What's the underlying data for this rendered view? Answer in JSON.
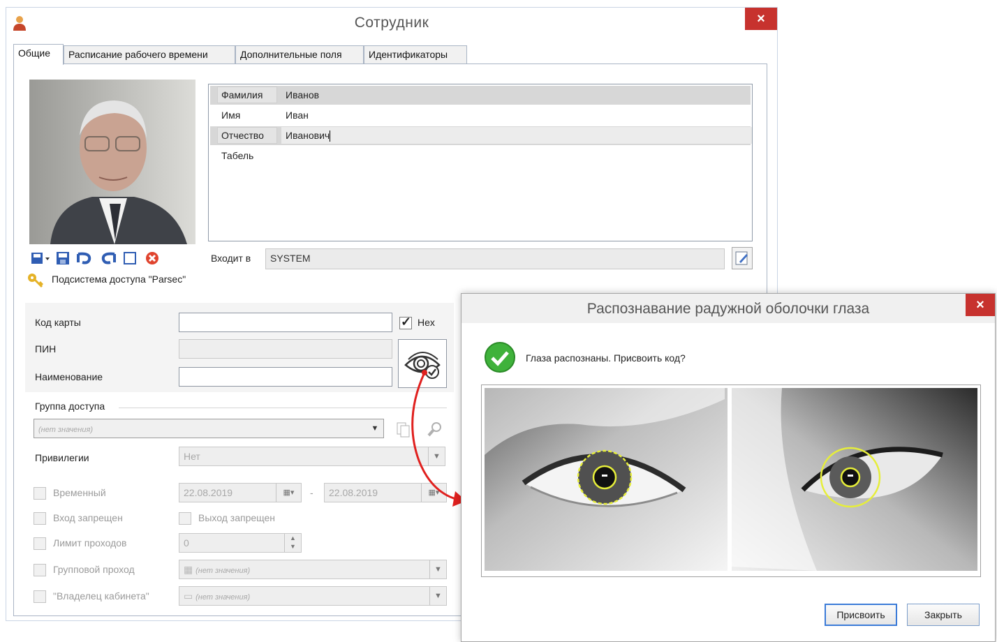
{
  "window": {
    "title": "Сотрудник",
    "close": "×"
  },
  "tabs": [
    {
      "label": "Общие"
    },
    {
      "label": "Расписание рабочего времени"
    },
    {
      "label": "Дополнительные поля"
    },
    {
      "label": "Идентификаторы"
    }
  ],
  "person": {
    "rows": [
      {
        "key": "Фамилия",
        "value": "Иванов"
      },
      {
        "key": "Имя",
        "value": "Иван"
      },
      {
        "key": "Отчество",
        "value": "Иванович"
      },
      {
        "key": "Табель",
        "value": ""
      }
    ]
  },
  "org": {
    "label": "Входит в",
    "value": "SYSTEM"
  },
  "subsystem": {
    "label": "Подсистема доступа \"Parsec\""
  },
  "access": {
    "card_code_label": "Код карты",
    "card_code_value": "",
    "hex_label": "Hex",
    "hex_checked": true,
    "pin_label": "ПИН",
    "name_label": "Наименование",
    "name_value": "",
    "group_label": "Группа доступа",
    "group_placeholder": "(нет значения)",
    "privileges_label": "Привилегии",
    "privileges_value": "Нет",
    "temporary_label": "Временный",
    "date_from": "22.08.2019",
    "date_to": "22.08.2019",
    "date_sep": "-",
    "entry_forbidden_label": "Вход запрещен",
    "exit_forbidden_label": "Выход запрещен",
    "pass_limit_label": "Лимит проходов",
    "pass_limit_value": "0",
    "group_pass_label": "Групповой проход",
    "group_pass_value": "(нет значения)",
    "office_owner_label": "\"Владелец кабинета\"",
    "office_owner_value": "(нет значения)"
  },
  "icons": {
    "app": "person-icon",
    "save_menu": "save-dropdown-icon",
    "save": "save-icon",
    "undo": "undo-icon",
    "redo": "redo-icon",
    "blank": "blank-page-icon",
    "delete": "delete-icon",
    "edit": "edit-icon",
    "key": "key-icon",
    "iris": "iris-scan-icon",
    "success": "check-circle-icon"
  },
  "dialog": {
    "title": "Распознавание радужной оболочки глаза",
    "close": "×",
    "message": "Глаза распознаны. Присвоить код?",
    "assign_button": "Присвоить",
    "close_button": "Закрыть"
  },
  "colors": {
    "close_red": "#c7322e",
    "arrow_red": "#e0201e",
    "iris_ring": "#e6ee3a",
    "success_green": "#3fb23b",
    "selection_gray": "#d7d7d7"
  }
}
